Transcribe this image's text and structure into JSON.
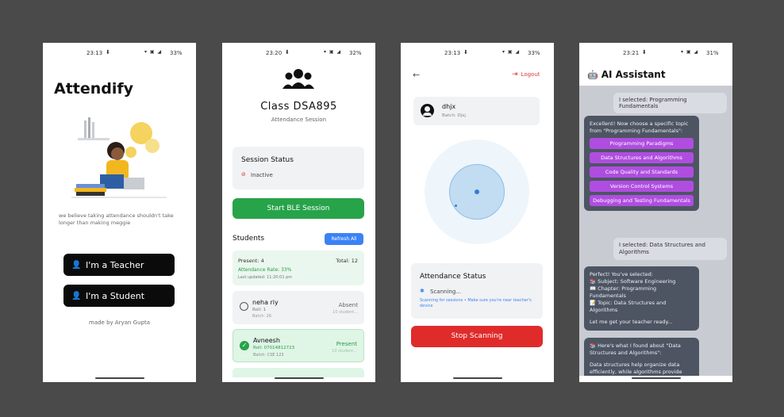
{
  "screen1": {
    "status": {
      "time": "23:13",
      "battery": "33%"
    },
    "app_title": "Attendify",
    "tagline": "we believe taking attendance shouldn't take longer than making meggie",
    "teacher_button": "I'm a Teacher",
    "student_button": "I'm a Student",
    "credit": "made by Aryan Gupta"
  },
  "screen2": {
    "status": {
      "time": "23:20",
      "battery": "32%"
    },
    "class_title": "Class DSA895",
    "subtitle": "Attendance Session",
    "session_status_label": "Session Status",
    "session_state": "Inactive",
    "start_button": "Start BLE Session",
    "students_heading": "Students",
    "refresh_button": "Refresh All",
    "summary": {
      "present": "Present: 4",
      "total": "Total: 12",
      "rate": "Attendance Rate: 33%",
      "updated": "Last updated: 11:20:01 pm"
    },
    "students": [
      {
        "name": "neha riy",
        "roll": "Roll: 1",
        "batch": "Batch: 26",
        "status": "Absent",
        "note": "10 student...",
        "present": false
      },
      {
        "name": "Avneesh",
        "roll": "Roll: 07014812723",
        "batch": "Batch: CSE 123",
        "status": "Present",
        "note": "10 student...",
        "present": true
      }
    ]
  },
  "screen3": {
    "status": {
      "time": "23:13",
      "battery": "33%"
    },
    "logout": "Logout",
    "user_name": "dhjx",
    "user_batch": "Batch: Djxj",
    "attendance_status_label": "Attendance Status",
    "scan_state": "Scanning...",
    "scan_hint": "Scanning for sessions • Make sure you're near teacher's device",
    "stop_button": "Stop Scanning"
  },
  "screen4": {
    "status": {
      "time": "23:21",
      "battery": "31%"
    },
    "title": "AI Assistant",
    "msg_user1": "I selected: Programming Fundamentals",
    "msg_bot1": "Excellent! Now choose a specific topic from \"Programming Fundamentals\":",
    "options": [
      "Programming Paradigms",
      "Data Structures and Algorithms",
      "Code Quality and Standards",
      "Version Control Systems",
      "Debugging and Testing Fundamentals"
    ],
    "msg_user2": "I selected: Data Structures and Algorithms",
    "msg_bot2_intro": "Perfect! You've selected:",
    "msg_bot2_subject": "📚 Subject: Software Engineering",
    "msg_bot2_chapter": "📖 Chapter: Programming Fundamentals",
    "msg_bot2_topic": "📝 Topic: Data Structures and Algorithms",
    "msg_bot2_outro": "Let me get your teacher ready...",
    "msg_bot3_head": "📚 Here's what I found about \"Data Structures and Algorithms\":",
    "msg_bot3_body": "Data structures help organize data efficiently, while algorithms provide"
  }
}
